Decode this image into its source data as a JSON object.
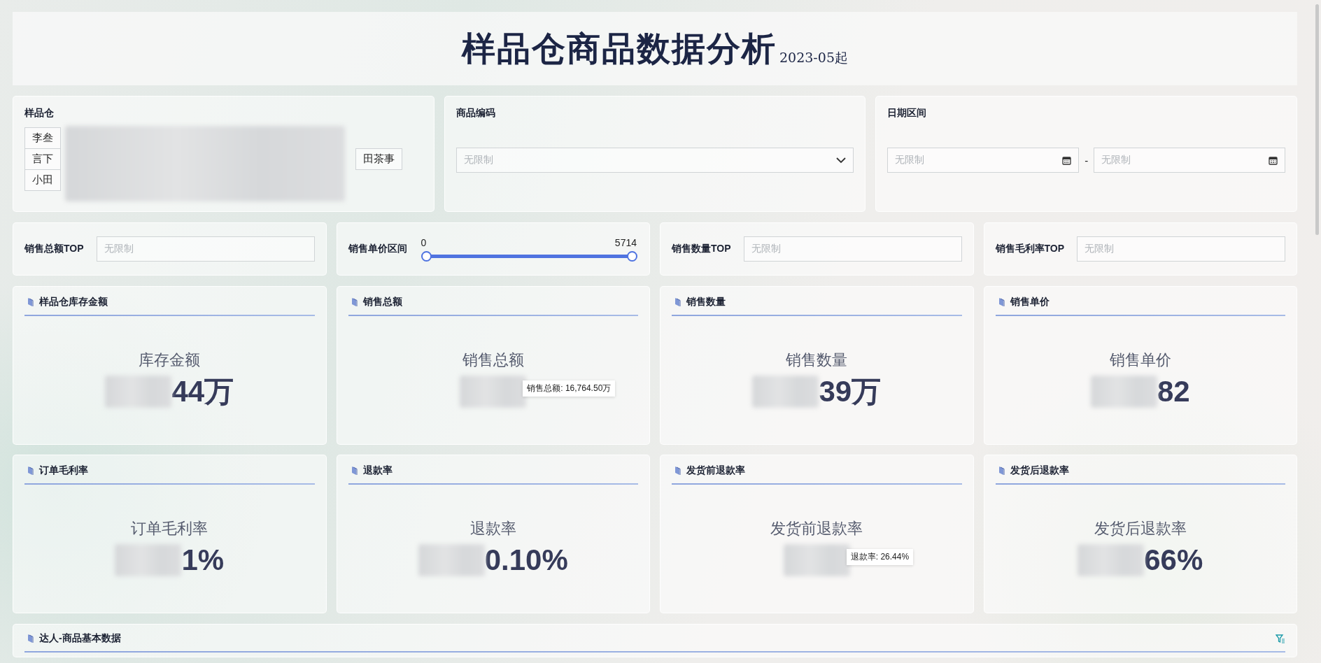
{
  "header": {
    "title": "样品仓商品数据分析",
    "subtitle": "2023-05起"
  },
  "filters": [
    {
      "kind": "tags",
      "label": "样品仓",
      "tag_rows": [
        [
          "李叁"
        ],
        [
          "言下",
          "田茶事"
        ],
        [
          "小田"
        ]
      ]
    },
    {
      "kind": "select",
      "label": "商品编码",
      "placeholder": "无限制"
    },
    {
      "kind": "daterange",
      "label": "日期区间",
      "start_placeholder": "无限制",
      "separator": "-",
      "end_placeholder": "无限制"
    }
  ],
  "conditions": [
    {
      "kind": "input",
      "label": "销售总额TOP",
      "placeholder": "无限制"
    },
    {
      "kind": "slider",
      "label": "销售单价区间",
      "min": "0",
      "max": "5714",
      "thumbs": [
        {
          "level": 0
        },
        {
          "level": 1
        }
      ]
    },
    {
      "kind": "input",
      "label": "销售数量TOP",
      "placeholder": "无限制"
    },
    {
      "kind": "input",
      "label": "销售毛利率TOP",
      "placeholder": "无限制"
    }
  ],
  "kpis": [
    {
      "title": "样品仓库存金额",
      "label": "库存金额",
      "value": "44万"
    },
    {
      "title": "销售总额",
      "label": "销售总额",
      "tooltip": "销售总额: 16,764.50万"
    },
    {
      "title": "销售数量",
      "label": "销售数量",
      "value": "39万"
    },
    {
      "title": "销售单价",
      "label": "销售单价",
      "value": "82"
    },
    {
      "title": "订单毛利率",
      "label": "订单毛利率",
      "value": "1%"
    },
    {
      "title": "退款率",
      "label": "退款率",
      "value": "0.10%"
    },
    {
      "title": "发货前退款率",
      "label": "发货前退款率",
      "tooltip": "退款率: 26.44%"
    },
    {
      "title": "发货后退款率",
      "label": "发货后退款率",
      "value": "66%"
    }
  ],
  "section": {
    "title": "达人-商品基本数据"
  }
}
